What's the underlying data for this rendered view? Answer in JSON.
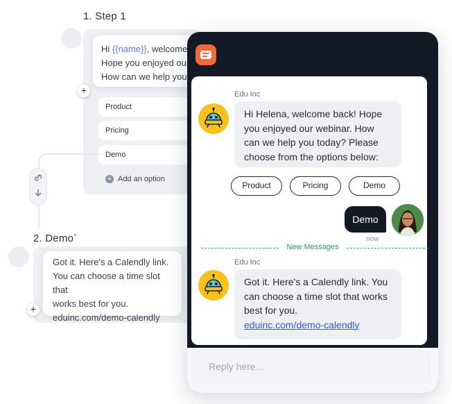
{
  "flow": {
    "step1_title": "1. Step 1",
    "step1_message": {
      "greeting_prefix": "Hi ",
      "variable": "{{name}}",
      "greeting_suffix": ", welcome back!",
      "line2": "Hope you enjoyed our webinar.",
      "line3": "How can we help you..."
    },
    "options": [
      "Product",
      "Pricing",
      "Demo"
    ],
    "add_option_label": "Add an option",
    "step2_title": "2. Demo`",
    "step2_message": [
      "Got it. Here's a Calendly link.",
      "You can choose a time slot that",
      "works best for you.",
      "eduinc.com/demo-calendly"
    ],
    "plus_symbol": "+"
  },
  "chat": {
    "sender_name_1": "Edu Inc",
    "bot_message_1": "Hi Helena, welcome back! Hope you enjoyed our webinar. How can we help you today? Please choose from the options below:",
    "quick_replies": [
      "Product",
      "Pricing",
      "Demo"
    ],
    "user_message": "Demo",
    "user_timestamp": "now",
    "new_messages_label": "New Messages",
    "sender_name_2": "Edu Inc",
    "bot_message_2_text": "Got it. Here's a Calendly link. You can choose a time slot that works best for you.",
    "bot_message_2_link": "eduinc.com/demo-calendly",
    "reply_placeholder": "Reply here..."
  },
  "colors": {
    "brand_orange": "#f06a3b",
    "header_dark": "#131a26",
    "bot_yellow": "#f8c21b",
    "new_messages_green": "#2d9b5a",
    "link_blue": "#2c5bd8",
    "variable_blue": "#5b7be0"
  },
  "icons": [
    "chat-logo-icon",
    "robot-icon",
    "link-icon",
    "arrow-down-icon",
    "plus-icon",
    "user-photo"
  ]
}
